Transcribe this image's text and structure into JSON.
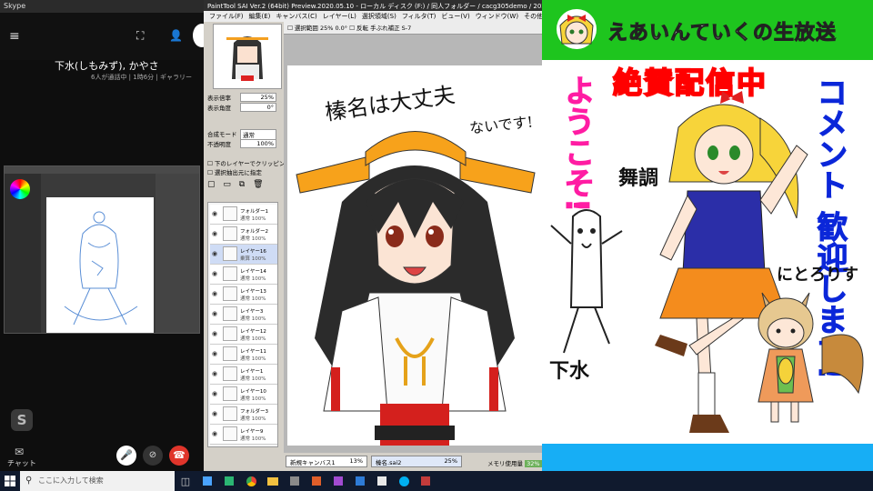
{
  "skype": {
    "window_title": "Skype",
    "call_name": "下水(しもみず), かやさ",
    "call_status": "6人が通話中 | 1時6分 | ギャラリー",
    "chat_label": "チャット"
  },
  "sai": {
    "title": "PaintTool SAI Ver.2 (64bit) Preview.2020.05.10 - ローカル ディスク (F:) / 同人フォルダー / cacg305demo / 2020 / 榛名.sai2",
    "menu": [
      "ファイル(F)",
      "編集(E)",
      "キャンバス(C)",
      "レイヤー(L)",
      "選択領域(S)",
      "フィルタ(T)",
      "ビュー(V)",
      "ウィンドウ(W)",
      "その他"
    ],
    "zoom_label": "表示倍率",
    "zoom_value": "25%",
    "angle_label": "表示角度",
    "angle_value": "0°",
    "blend_mode_label": "合成モード",
    "blend_mode_value": "通常",
    "opacity_label": "不透明度",
    "opacity_value": "100%",
    "clip_label": "下のレイヤーでクリッピング",
    "select_label": "選択抽出元に指定",
    "toolbar_text": "☐ 選択範囲  25%   0.0°   ☐ 反転   手ぶれ補正 S-7",
    "layers": [
      {
        "name": "フォルダー1",
        "sub": "通常 100%"
      },
      {
        "name": "フォルダー2",
        "sub": "通常 100%"
      },
      {
        "name": "レイヤー16",
        "sub": "乗算 100%"
      },
      {
        "name": "レイヤー14",
        "sub": "通常 100%"
      },
      {
        "name": "レイヤー13",
        "sub": "通常 100%"
      },
      {
        "name": "レイヤー3",
        "sub": "通常 100%"
      },
      {
        "name": "レイヤー12",
        "sub": "通常 100%"
      },
      {
        "name": "レイヤー11",
        "sub": "通常 100%"
      },
      {
        "name": "レイヤー1",
        "sub": "通常 100%"
      },
      {
        "name": "レイヤー10",
        "sub": "通常 100%"
      },
      {
        "name": "フォルダー3",
        "sub": "通常 100%"
      },
      {
        "name": "レイヤー9",
        "sub": "通常 100%"
      }
    ],
    "tabs": [
      {
        "label": "新規キャンバス1",
        "zoom": "13%"
      },
      {
        "label": "榛名.sai2",
        "zoom": "25%"
      }
    ],
    "memory_label": "メモリ使用量",
    "memory_value": "32%",
    "canvas_text_1": "榛名は大丈夫",
    "canvas_text_2": "ないです!"
  },
  "overlay": {
    "title": "えあいんていくの生放送",
    "live": "絶賛配信中",
    "welcome": "ようこそ!",
    "comments_col1": "コメント",
    "comments_col2": "歓迎します!",
    "name_1": "舞調",
    "name_2": "下水",
    "name_3": "にとろりす"
  },
  "taskbar": {
    "search_placeholder": "ここに入力して検索"
  },
  "colors": {
    "overlay_header": "#1ec51e",
    "overlay_footer": "#17aef5",
    "live_text": "#ff0000",
    "welcome_text": "#ff1ca3",
    "comment_text": "#0b27d9",
    "hangup": "#e0352b"
  }
}
